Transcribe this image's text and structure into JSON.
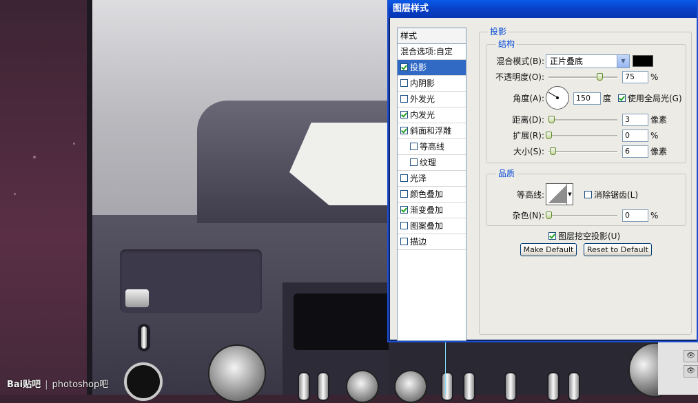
{
  "dialog": {
    "title": "图层样式",
    "styles_header": "样式",
    "blend_options": "混合选项:自定",
    "items": [
      {
        "label": "投影",
        "checked": true,
        "selected": true,
        "indent": false
      },
      {
        "label": "内阴影",
        "checked": false,
        "selected": false,
        "indent": false
      },
      {
        "label": "外发光",
        "checked": false,
        "selected": false,
        "indent": false
      },
      {
        "label": "内发光",
        "checked": true,
        "selected": false,
        "indent": false
      },
      {
        "label": "斜面和浮雕",
        "checked": true,
        "selected": false,
        "indent": false
      },
      {
        "label": "等高线",
        "checked": false,
        "selected": false,
        "indent": true
      },
      {
        "label": "纹理",
        "checked": false,
        "selected": false,
        "indent": true
      },
      {
        "label": "光泽",
        "checked": false,
        "selected": false,
        "indent": false
      },
      {
        "label": "颜色叠加",
        "checked": false,
        "selected": false,
        "indent": false
      },
      {
        "label": "渐变叠加",
        "checked": true,
        "selected": false,
        "indent": false
      },
      {
        "label": "图案叠加",
        "checked": false,
        "selected": false,
        "indent": false
      },
      {
        "label": "描边",
        "checked": false,
        "selected": false,
        "indent": false
      }
    ],
    "section_title": "投影",
    "structure": {
      "title": "结构",
      "blend_mode_label": "混合模式(B):",
      "blend_mode_value": "正片叠底",
      "shadow_color": "#000000",
      "opacity_label": "不透明度(O):",
      "opacity_value": "75",
      "opacity_unit": "%",
      "angle_label": "角度(A):",
      "angle_value": "150",
      "angle_unit": "度",
      "global_light_label": "使用全局光(G)",
      "global_light_checked": true,
      "distance_label": "距离(D):",
      "distance_value": "3",
      "distance_unit": "像素",
      "spread_label": "扩展(R):",
      "spread_value": "0",
      "spread_unit": "%",
      "size_label": "大小(S):",
      "size_value": "6",
      "size_unit": "像素"
    },
    "quality": {
      "title": "品质",
      "contour_label": "等高线:",
      "anti_alias_label": "消除锯齿(L)",
      "anti_alias_checked": false,
      "noise_label": "杂色(N):",
      "noise_value": "0",
      "noise_unit": "%"
    },
    "knockout_label": "图层挖空投影(U)",
    "knockout_checked": true,
    "make_default": "Make Default",
    "reset_default": "Reset to Default"
  },
  "watermark": {
    "brand": "Bai贴吧",
    "name": "photoshop吧"
  }
}
